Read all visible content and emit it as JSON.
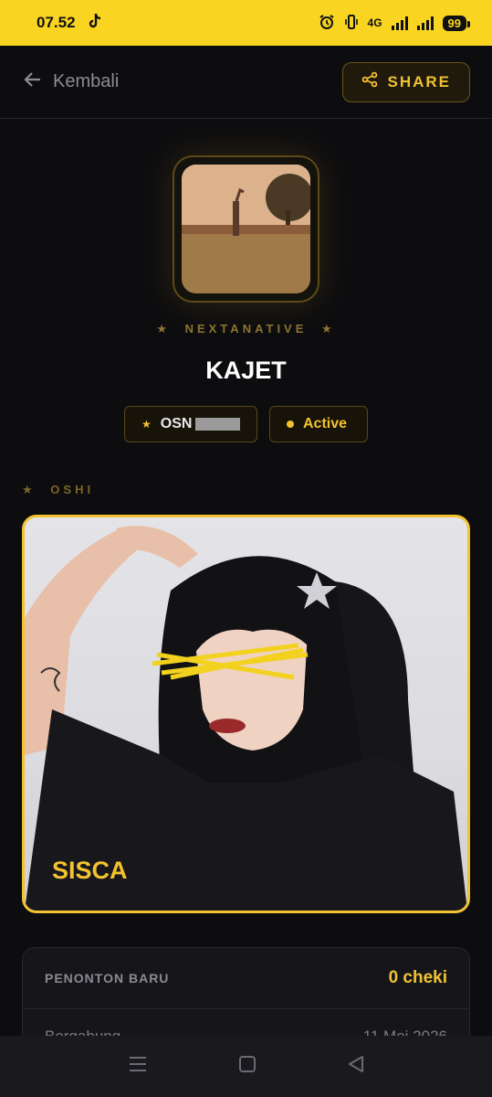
{
  "status_bar": {
    "time": "07.52",
    "network": "4G",
    "battery": "99"
  },
  "topbar": {
    "back_label": "Kembali",
    "share_label": "SHARE"
  },
  "profile": {
    "group": "NEXTANATIVE",
    "name": "KAJET",
    "member_id_prefix": "OSN",
    "status": "Active"
  },
  "oshi": {
    "section_label": "OSHI",
    "name": "SISCA"
  },
  "stats": {
    "label": "PENONTON BARU",
    "value": "0 cheki",
    "joined_label": "Bergabung",
    "joined_date": "11 Mei 2026"
  },
  "colors": {
    "accent": "#f2c230",
    "status_bar": "#f9d521",
    "background": "#0d0d10"
  }
}
